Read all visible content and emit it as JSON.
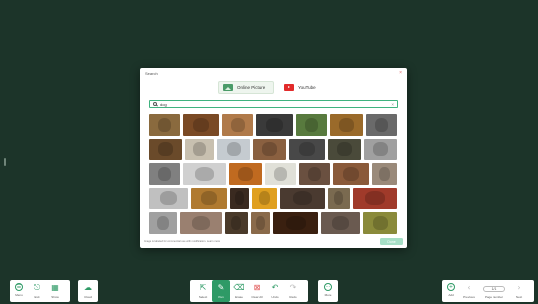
{
  "dialog": {
    "title": "Search",
    "close_glyph": "×",
    "tabs": [
      {
        "label": "Online Picture",
        "icon": "picture-icon",
        "active": true
      },
      {
        "label": "YouTube",
        "icon": "youtube-icon",
        "active": false
      }
    ],
    "search": {
      "value": "dog",
      "placeholder": ""
    },
    "license_text": "Image is labeled for commercial use with modification. Learn more",
    "done_label": "Done",
    "image_colors": [
      [
        "#8a6a3e",
        "#7a4a25",
        "#b07a4a",
        "#3a3a3a",
        "#587a3e",
        "#9a6a2a",
        "#6a6a6a"
      ],
      [
        "#6a4a2a",
        "#c8c0b0",
        "#c5cbd0",
        "#8a6040",
        "#484848",
        "#4a4a3a",
        "#a0a0a0"
      ],
      [
        "#808080",
        "#d0d0d0",
        "#c06a20",
        "#e0e0d8",
        "#6a5040",
        "#8a5a3a",
        "#9a8a7a"
      ],
      [
        "#c0c0c0",
        "#b07a30",
        "#3a2a20",
        "#e0a020",
        "#4a3a30",
        "#7a6a50",
        "#a03a2a"
      ],
      [
        "#a0a0a0",
        "#9a8070",
        "#4a3a2a",
        "#8a6a4a",
        "#3a2010",
        "#6a5a50",
        "#8a8a3a"
      ]
    ],
    "row_weights": [
      [
        1,
        1.2,
        1,
        1.2,
        1,
        1.1,
        1
      ],
      [
        1,
        0.9,
        1,
        1,
        1.1,
        1,
        1
      ],
      [
        1,
        1.4,
        1.1,
        1,
        1,
        1.2,
        0.8
      ],
      [
        1.4,
        1.3,
        0.7,
        0.9,
        1.6,
        0.8,
        1.6
      ],
      [
        1,
        1.5,
        0.8,
        0.7,
        1.6,
        1.4,
        1.2
      ]
    ]
  },
  "toolbar_left": [
    {
      "label": "Menu",
      "icon": "menu-icon",
      "glyph": "☰"
    },
    {
      "label": "Exit",
      "icon": "exit-icon",
      "glyph": "⎋"
    },
    {
      "label": "Show",
      "icon": "show-grid-icon",
      "glyph": "▦"
    }
  ],
  "toolbar_cloud": {
    "label": "Cloud",
    "icon": "cloud-icon",
    "glyph": "☁"
  },
  "toolbar_center": [
    {
      "label": "Select",
      "icon": "select-cursor-icon",
      "glyph": "⇱"
    },
    {
      "label": "Pen",
      "icon": "pen-icon",
      "glyph": "✎"
    },
    {
      "label": "Erase",
      "icon": "eraser-icon",
      "glyph": "⌫"
    },
    {
      "label": "Clear All",
      "icon": "clear-all-icon",
      "glyph": "⊠"
    },
    {
      "label": "Undo",
      "icon": "undo-icon",
      "glyph": "↶"
    },
    {
      "label": "Redo",
      "icon": "redo-icon",
      "glyph": "↷"
    }
  ],
  "toolbar_more": {
    "label": "More",
    "icon": "more-icon",
    "glyph": "⋯"
  },
  "toolbar_right": {
    "add": {
      "label": "Add",
      "glyph": "+"
    },
    "previous": {
      "label": "Previous",
      "glyph": "‹"
    },
    "page_counter": "1/1",
    "page_number_label": "Page number",
    "next": {
      "label": "Next",
      "glyph": "›"
    }
  },
  "colors": {
    "accent": "#2e9a66",
    "background": "#1c3429"
  }
}
